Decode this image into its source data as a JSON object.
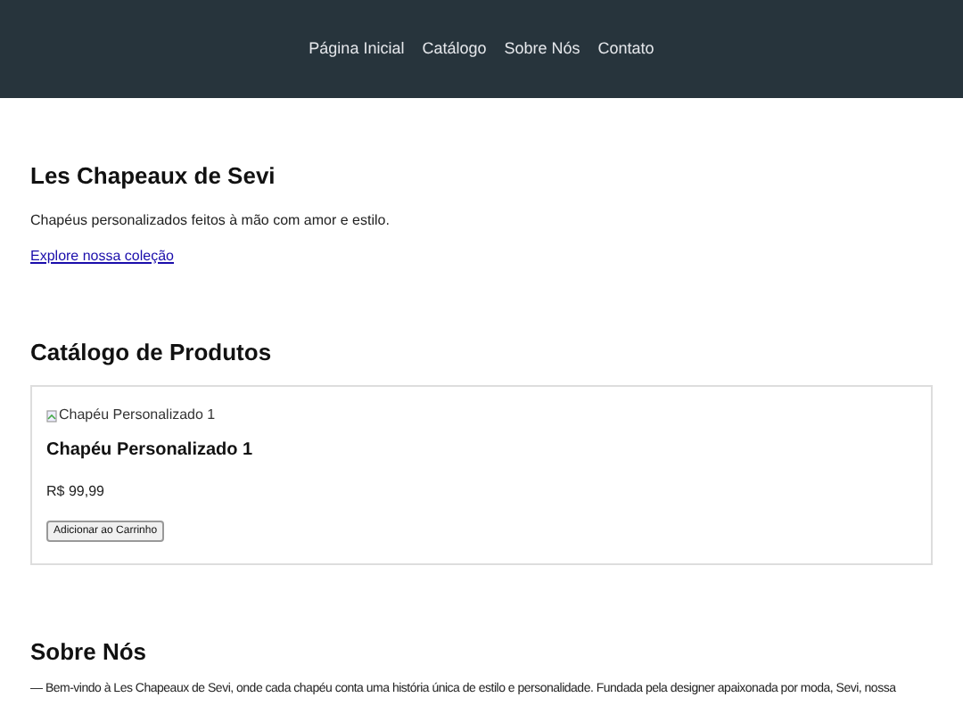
{
  "nav": {
    "items": [
      {
        "label": "Página Inicial"
      },
      {
        "label": "Catálogo"
      },
      {
        "label": "Sobre Nós"
      },
      {
        "label": "Contato"
      }
    ]
  },
  "hero": {
    "title": "Les Chapeaux de Sevi",
    "tagline": "Chapéus personalizados feitos à mão com amor e estilo.",
    "link": "Explore nossa coleção"
  },
  "catalog": {
    "title": "Catálogo de Produtos",
    "products": [
      {
        "image_alt": "Chapéu Personalizado 1",
        "name": "Chapéu Personalizado 1",
        "price": "R$ 99,99",
        "button": "Adicionar ao Carrinho"
      }
    ]
  },
  "about": {
    "title": "Sobre Nós",
    "text": "— Bem-vindo à Les Chapeaux de Sevi, onde cada chapéu conta uma história única de estilo e personalidade. Fundada pela designer apaixonada por moda, Sevi, nossa"
  }
}
